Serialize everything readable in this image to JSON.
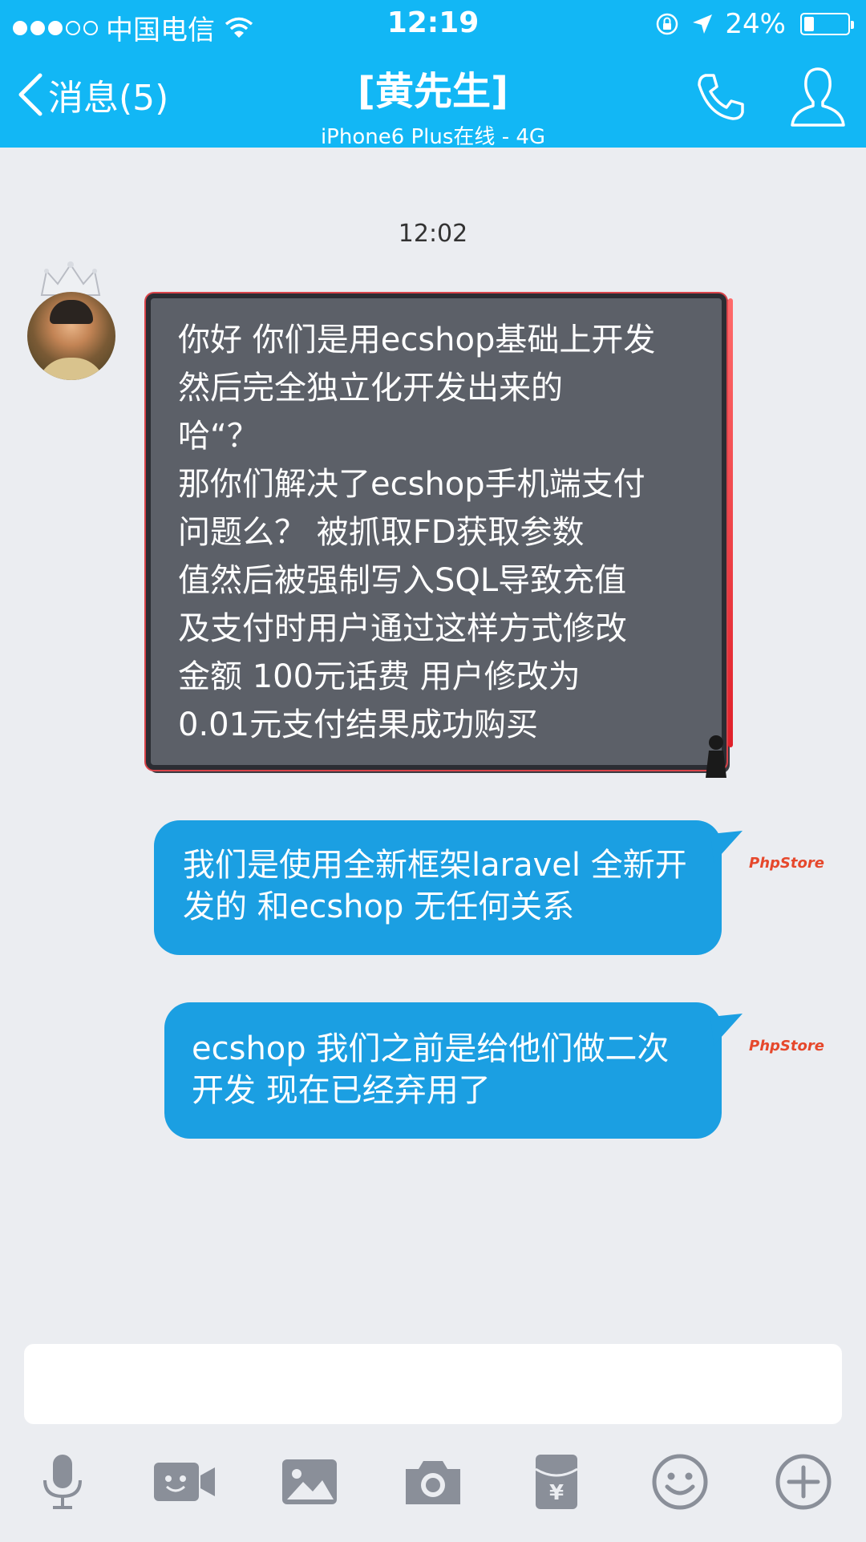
{
  "status_bar": {
    "carrier": "中国电信",
    "time": "12:19",
    "battery": "24%",
    "battery_level": 0.24
  },
  "header": {
    "back_label": "消息(5)",
    "title": "[黄先生]",
    "subtitle": "iPhone6 Plus在线 - 4G",
    "icons": [
      "back-chevron-icon",
      "phone-icon",
      "profile-icon"
    ]
  },
  "chat": {
    "timestamp": "12:02",
    "incoming_message": "你好 你们是用ecshop基础上开发\n然后完全独立化开发出来的\n哈“？\n那你们解决了ecshop手机端支付\n问题么？    被抓取FD获取参数\n值然后被强制写入SQL导致充值\n及支付时用户通过这样方式修改\n金额  100元话费 用户修改为\n0.01元支付结果成功购买",
    "outgoing_messages": [
      {
        "text": "我们是使用全新框架laravel 全新开发的 和ecshop 无任何关系",
        "tag": "PhpStore"
      },
      {
        "text": "ecshop 我们之前是给他们做二次开发 现在已经弃用了",
        "tag": "PhpStore"
      }
    ]
  },
  "input": {
    "placeholder": ""
  },
  "toolbar": {
    "icons": [
      "microphone-icon",
      "video-call-icon",
      "image-icon",
      "camera-icon",
      "red-packet-icon",
      "emoji-icon",
      "plus-icon"
    ]
  },
  "colors": {
    "header_bg": "#12b7f5",
    "bubble_bg": "#1b9fe2",
    "chat_bg": "#ebedf1",
    "board_bg": "#5c6068",
    "icon_gray": "#8a8f99"
  }
}
